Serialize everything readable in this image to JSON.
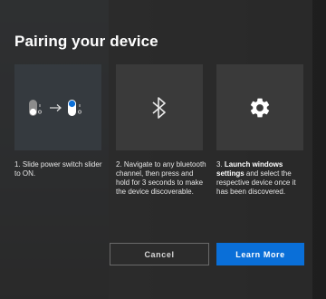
{
  "dialog": {
    "title": "Pairing your device"
  },
  "steps": [
    {
      "icon": "power-switch-icon",
      "text": "1. Slide power switch slider to ON."
    },
    {
      "icon": "bluetooth-icon",
      "text": "2. Navigate to any bluetooth channel, then press and hold for 3 seconds to make the device discoverable."
    },
    {
      "icon": "gear-icon",
      "bold": "Launch windows settings",
      "prefix": "3. ",
      "suffix": " and select the respective device once it has been discovered."
    }
  ],
  "buttons": {
    "cancel_label": "Cancel",
    "learn_more_label": "Learn More"
  },
  "colors": {
    "accent": "#0a6fd8",
    "dialog_bg": "#2c2c2c"
  }
}
